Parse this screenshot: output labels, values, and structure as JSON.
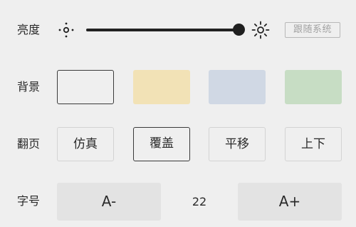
{
  "brightness": {
    "label": "亮度",
    "level_percent": 100,
    "follow_system_label": "跟随系统",
    "min_icon": "sun-small-icon",
    "max_icon": "sun-large-icon"
  },
  "background": {
    "label": "背景",
    "selected_index": 0,
    "options": [
      {
        "name": "white",
        "color": "#efefef"
      },
      {
        "name": "yellow",
        "color": "#f2e2b6"
      },
      {
        "name": "blue",
        "color": "#d0d8e4"
      },
      {
        "name": "green",
        "color": "#c7ddc4"
      }
    ]
  },
  "page_turn": {
    "label": "翻页",
    "selected_index": 1,
    "options": [
      "仿真",
      "覆盖",
      "平移",
      "上下"
    ]
  },
  "font_size": {
    "label": "字号",
    "decrease_label": "A-",
    "value": "22",
    "increase_label": "A+"
  },
  "colors": {
    "accent": "#1f1f1f",
    "page_bg": "#efefef"
  }
}
